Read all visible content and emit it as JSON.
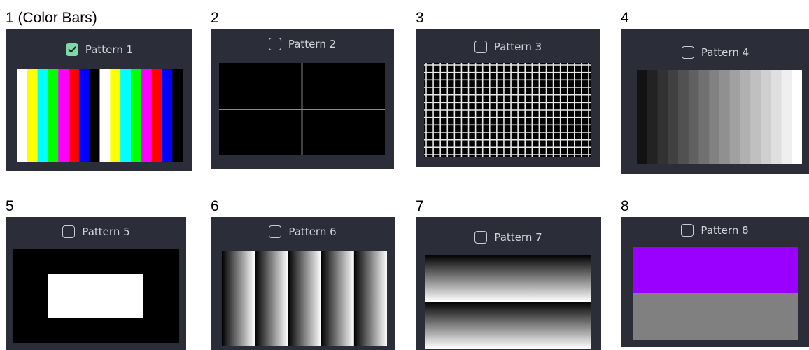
{
  "patterns": [
    {
      "caption": "1 (Color Bars)",
      "label": "Pattern 1",
      "checked": true
    },
    {
      "caption": "2",
      "label": "Pattern 2",
      "checked": false
    },
    {
      "caption": "3",
      "label": "Pattern 3",
      "checked": false
    },
    {
      "caption": "4",
      "label": "Pattern 4",
      "checked": false
    },
    {
      "caption": "5",
      "label": "Pattern 5",
      "checked": false
    },
    {
      "caption": "6",
      "label": "Pattern 6",
      "checked": false
    },
    {
      "caption": "7",
      "label": "Pattern 7",
      "checked": false
    },
    {
      "caption": "8",
      "label": "Pattern 8",
      "checked": false
    }
  ],
  "colors": {
    "panel_bg": "#2b2e38",
    "checkbox_checked": "#7fd8a6",
    "color_bars": [
      "#ffffff",
      "#ffff00",
      "#00ffff",
      "#00ff00",
      "#ff00ff",
      "#ff0000",
      "#0000ff",
      "#000000"
    ],
    "pattern8_top": "#9900ff",
    "pattern8_bottom": "#808080"
  }
}
